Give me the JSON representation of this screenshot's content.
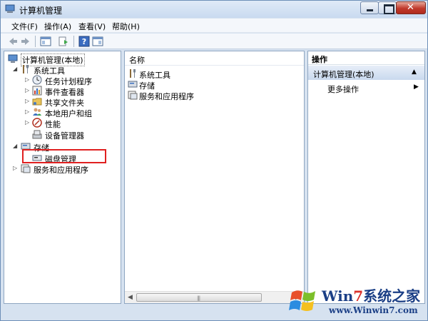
{
  "window": {
    "title": "计算机管理"
  },
  "menu": {
    "items": [
      "文件(F)",
      "操作(A)",
      "查看(V)",
      "帮助(H)"
    ]
  },
  "tree": {
    "root": "计算机管理(本地)",
    "system_tools": "系统工具",
    "task_scheduler": "任务计划程序",
    "event_viewer": "事件查看器",
    "shared_folders": "共享文件夹",
    "local_users": "本地用户和组",
    "performance": "性能",
    "device_manager": "设备管理器",
    "storage": "存储",
    "disk_management": "磁盘管理",
    "services_apps": "服务和应用程序"
  },
  "list": {
    "column_name": "名称",
    "items": [
      "系统工具",
      "存储",
      "服务和应用程序"
    ]
  },
  "actions": {
    "header": "操作",
    "section": "计算机管理(本地)",
    "more": "更多操作"
  },
  "watermark": {
    "title_prefix": "Win",
    "title_seven": "7",
    "title_suffix": "系统之家",
    "url": "www.Winwin7.com"
  },
  "colors": {
    "highlight_box": "#e02020",
    "action_section": "#c9d9ee",
    "watermark_blue": "#1b3f86"
  }
}
